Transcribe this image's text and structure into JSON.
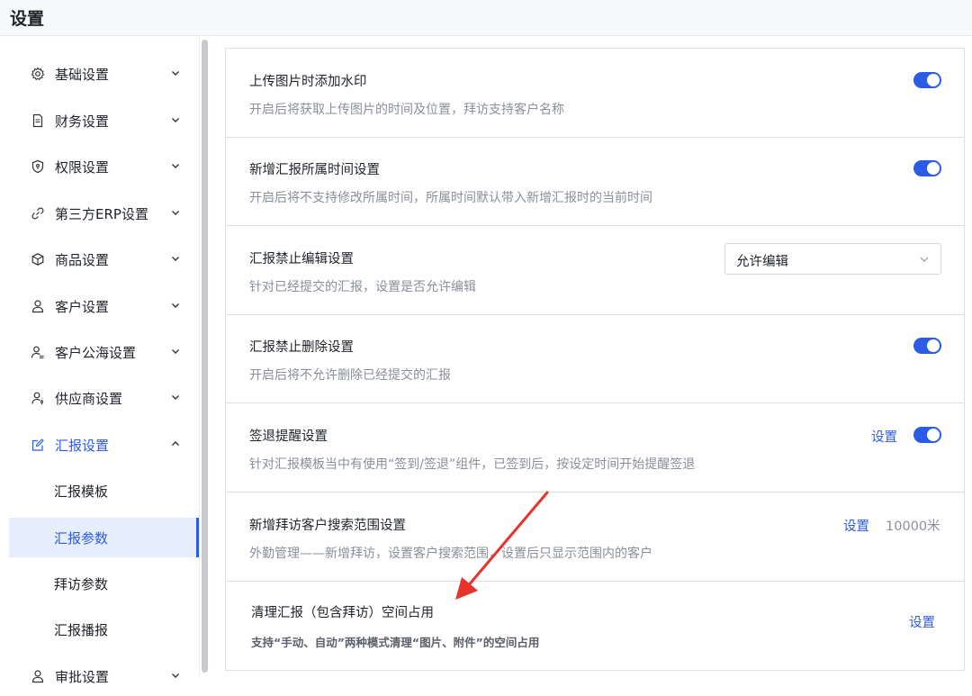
{
  "header": {
    "title": "设置"
  },
  "sidebar": {
    "items": [
      {
        "label": "基础设置",
        "icon": "gear-icon",
        "expanded": false
      },
      {
        "label": "财务设置",
        "icon": "document-icon",
        "expanded": false
      },
      {
        "label": "权限设置",
        "icon": "shield-icon",
        "expanded": false
      },
      {
        "label": "第三方ERP设置",
        "icon": "link-icon",
        "expanded": false
      },
      {
        "label": "商品设置",
        "icon": "box-icon",
        "expanded": false
      },
      {
        "label": "客户设置",
        "icon": "user-icon",
        "expanded": false
      },
      {
        "label": "客户公海设置",
        "icon": "user-group-icon",
        "expanded": false
      },
      {
        "label": "供应商设置",
        "icon": "user-tie-icon",
        "expanded": false
      },
      {
        "label": "汇报设置",
        "icon": "edit-icon",
        "expanded": true
      },
      {
        "label": "审批设置",
        "icon": "user-icon",
        "expanded": false
      }
    ],
    "sub_items": [
      {
        "label": "汇报模板",
        "selected": false
      },
      {
        "label": "汇报参数",
        "selected": true
      },
      {
        "label": "拜访参数",
        "selected": false
      },
      {
        "label": "汇报播报",
        "selected": false
      }
    ]
  },
  "settings": {
    "rows": [
      {
        "title": "上传图片时添加水印",
        "desc": "开启后将获取上传图片的时间及位置，拜访支持客户名称",
        "toggle": true
      },
      {
        "title": "新增汇报所属时间设置",
        "desc": "开启后将不支持修改所属时间，所属时间默认带入新增汇报时的当前时间",
        "toggle": true
      },
      {
        "title": "汇报禁止编辑设置",
        "desc": "针对已经提交的汇报，设置是否允许编辑",
        "select_value": "允许编辑"
      },
      {
        "title": "汇报禁止删除设置",
        "desc": "开启后将不允许删除已经提交的汇报",
        "toggle": true
      },
      {
        "title": "签退提醒设置",
        "desc": "针对汇报模板当中有使用“签到/签退”组件，已签到后，按设定时间开始提醒签退",
        "link": "设置",
        "toggle": true
      },
      {
        "title": "新增拜访客户搜索范围设置",
        "desc": "外勤管理——新增拜访，设置客户搜索范围，设置后只显示范围内的客户",
        "link": "设置",
        "value": "10000米"
      },
      {
        "title": "清理汇报（包含拜访）空间占用",
        "desc": "支持“手动、自动”两种模式清理“图片、附件”的空间占用",
        "link": "设置"
      }
    ]
  },
  "colors": {
    "accent": "#2b5ce6",
    "annotation_arrow": "#e8332a"
  }
}
